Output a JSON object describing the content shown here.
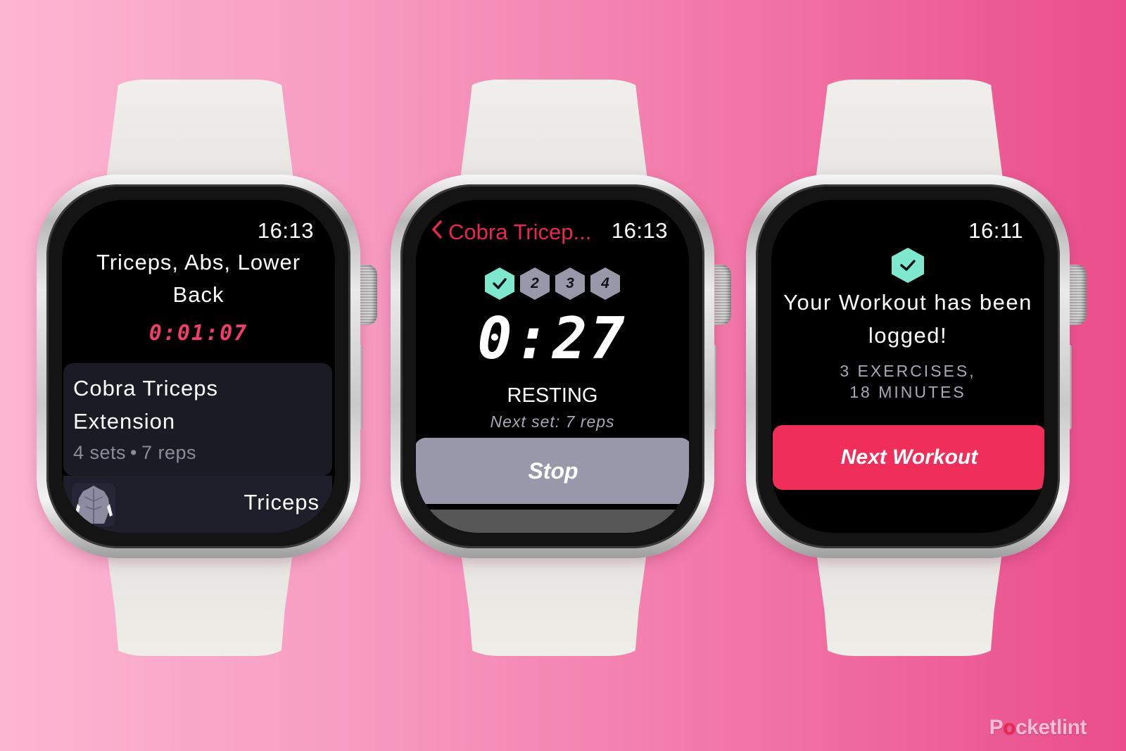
{
  "colors": {
    "accent_red": "#ef2f5a",
    "timer_red": "#ef3e68",
    "complete_teal": "#7ee8cf",
    "muted_lavender": "#9998ab",
    "card_bg": "#1b1b26"
  },
  "watches": [
    {
      "time": "16:13",
      "workout_title": "Triceps, Abs, Lower Back",
      "elapsed_timer": "0:01:07",
      "exercise": {
        "name": "Cobra Triceps Extension",
        "sets": "4 sets",
        "separator": "•",
        "reps": "7 reps"
      },
      "muscle": {
        "icon": "muscle-body-icon",
        "label": "Triceps"
      }
    },
    {
      "time": "16:13",
      "back_icon": "chevron-left-icon",
      "back_label": "Cobra Tricep...",
      "sets": [
        {
          "label": "✓",
          "status": "complete"
        },
        {
          "label": "2",
          "status": "pending"
        },
        {
          "label": "3",
          "status": "pending"
        },
        {
          "label": "4",
          "status": "pending"
        }
      ],
      "rest_timer": "0:27",
      "state": "RESTING",
      "next_set": "Next set: 7 reps",
      "stop_label": "Stop",
      "more_icon": "ellipsis-icon",
      "more_glyph": "•••"
    },
    {
      "time": "16:11",
      "check_icon": "checkmark-hexagon-icon",
      "message": "Your Workout has been logged!",
      "stats_line1": "3 Exercises,",
      "stats_line2": "18 Minutes",
      "next_label": "Next Workout"
    }
  ],
  "watermark": {
    "brand_start": "P",
    "brand_mark": "o",
    "brand_end": "cketlint"
  }
}
